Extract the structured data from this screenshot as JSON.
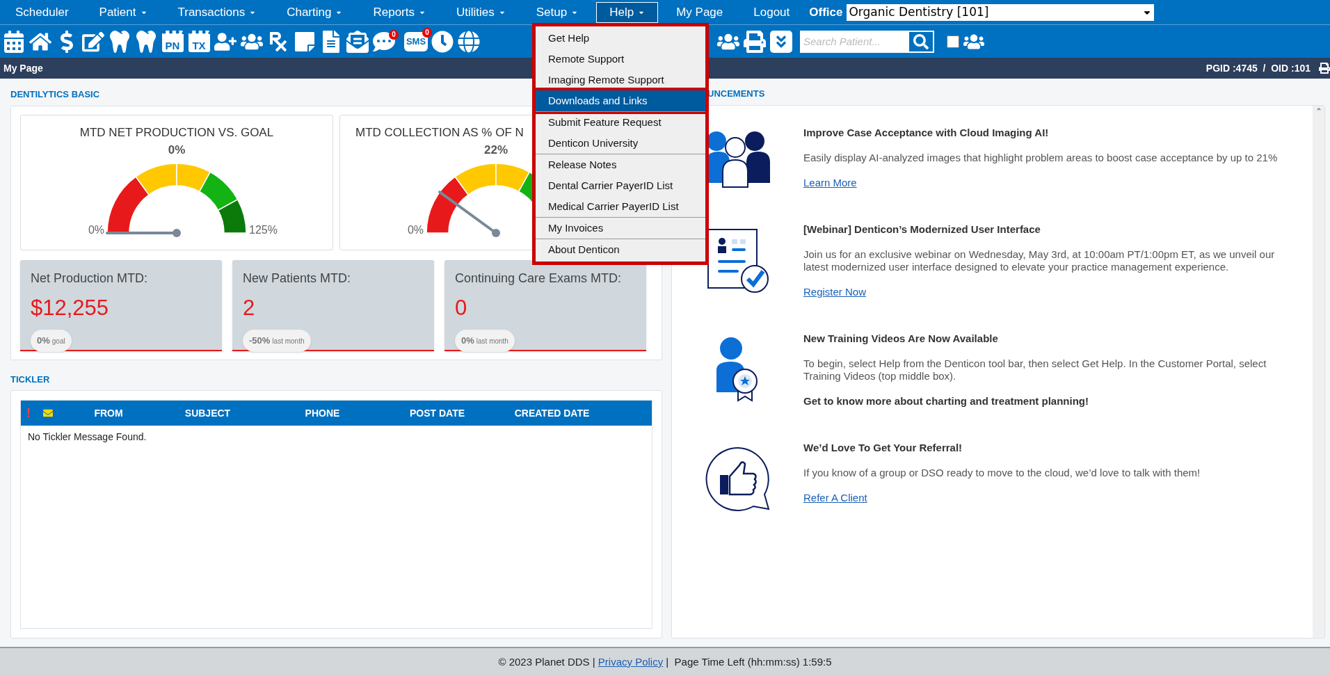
{
  "nav": {
    "items": [
      {
        "label": "Scheduler",
        "has_menu": false,
        "selected": false
      },
      {
        "label": "Patient",
        "has_menu": true,
        "selected": false
      },
      {
        "label": "Transactions",
        "has_menu": true,
        "selected": false
      },
      {
        "label": "Charting",
        "has_menu": true,
        "selected": false
      },
      {
        "label": "Reports",
        "has_menu": true,
        "selected": false
      },
      {
        "label": "Utilities",
        "has_menu": true,
        "selected": false
      },
      {
        "label": "Setup",
        "has_menu": true,
        "selected": false
      },
      {
        "label": "Help",
        "has_menu": true,
        "selected": true
      },
      {
        "label": "My Page",
        "has_menu": false,
        "selected": false
      },
      {
        "label": "Logout",
        "has_menu": false,
        "selected": false
      }
    ],
    "office_label": "Office",
    "office_value": "Organic Dentistry [101]"
  },
  "toolbar": {
    "pn_label": "PN",
    "tx_label": "TX",
    "message_badge": "0",
    "sms_label": "SMS",
    "sms_badge": "0",
    "search_placeholder": "Search Patient...",
    "include_inactive_checked": false
  },
  "page_bar": {
    "title": "My Page",
    "ids": "PGID :4745  /  OID :101"
  },
  "help_menu": {
    "groups": [
      [
        {
          "label": "Get Help",
          "selected": false
        },
        {
          "label": "Remote Support",
          "selected": false
        },
        {
          "label": "Imaging Remote Support",
          "selected": false
        },
        {
          "label": "Downloads and Links",
          "selected": true
        }
      ],
      [
        {
          "label": "Submit Feature Request",
          "selected": false
        },
        {
          "label": "Denticon University",
          "selected": false
        }
      ],
      [
        {
          "label": "Release Notes",
          "selected": false
        },
        {
          "label": "Dental Carrier PayerID List",
          "selected": false
        },
        {
          "label": "Medical Carrier PayerID List",
          "selected": false
        }
      ],
      [
        {
          "label": "My Invoices",
          "selected": false
        }
      ],
      [
        {
          "label": "About Denticon",
          "selected": false
        }
      ]
    ]
  },
  "dentilytics": {
    "heading": "DENTILYTICS BASIC",
    "gauges": [
      {
        "title": "MTD NET PRODUCTION VS. GOAL",
        "value": "0%",
        "min_label": "0%",
        "max_label": "125%",
        "level": 0
      },
      {
        "title": "MTD COLLECTION AS % OF N",
        "value": "22%",
        "min_label": "0%",
        "level": 0.2
      }
    ],
    "kpis": [
      {
        "title": "Net Production MTD:",
        "value": "$12,255",
        "change": "0%",
        "change_note": "goal"
      },
      {
        "title": "New Patients MTD:",
        "value": "2",
        "change": "-50%",
        "change_note": "last month"
      },
      {
        "title": "Continuing Care Exams MTD:",
        "value": "0",
        "change": "0%",
        "change_note": "last month"
      }
    ]
  },
  "tickler": {
    "heading": "TICKLER",
    "columns": [
      "!",
      "FROM",
      "SUBJECT",
      "PHONE",
      "POST DATE",
      "CREATED DATE"
    ],
    "empty_message": "No Tickler Message Found."
  },
  "announcements": {
    "heading": "UNCEMENTS",
    "items": [
      {
        "title": "Improve Case Acceptance with Cloud Imaging AI!",
        "body": "Easily display AI-analyzed images that highlight problem areas to boost case acceptance by up to 21%",
        "link": "Learn More"
      },
      {
        "title": "[Webinar] Denticon’s Modernized User Interface",
        "body": "Join us for an exclusive webinar on Wednesday, May 3rd, at 10:00am PT/1:00pm ET, as we unveil our latest modernized user interface designed to elevate your practice management experience.",
        "link": "Register Now"
      },
      {
        "title": "New Training Videos Are Now Available",
        "body": "To begin, select Help from the Denticon tool bar, then select Get Help. In the Customer Portal, select Training Videos (top middle box).",
        "emphasis": "Get to know more about charting and treatment planning!"
      },
      {
        "title": "We’d Love To Get Your Referral!",
        "body": "If you know of a group or DSO ready to move to the cloud, we’d love to talk with them!",
        "link": "Refer A Client"
      }
    ]
  },
  "footer": {
    "copyright": "© 2023 Planet DDS |",
    "link": "Privacy Policy",
    "timer": "|  Page Time Left (hh:mm:ss) 1:59:5"
  }
}
